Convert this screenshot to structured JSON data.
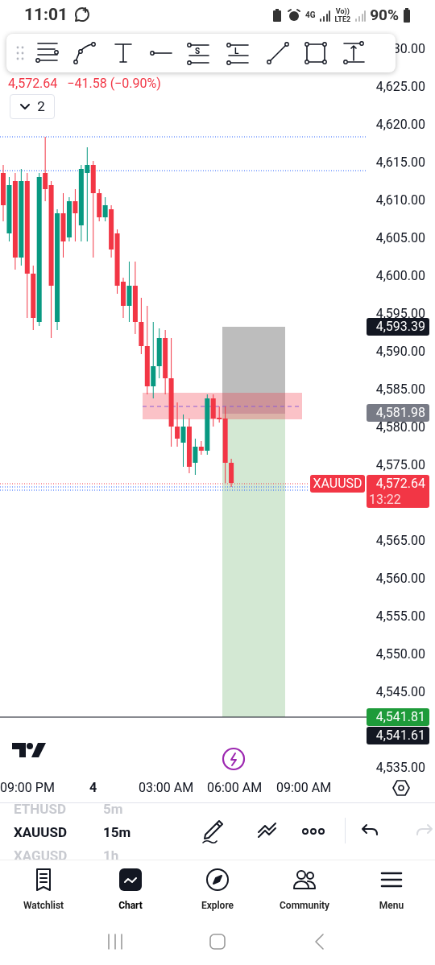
{
  "status_bar": {
    "time": "11:01",
    "network": [
      "4G",
      "Vo))",
      "LTE2"
    ],
    "battery": "90%"
  },
  "drawing_toolbar": {
    "tools": [
      {
        "kind": "fib"
      },
      {
        "kind": "curve"
      },
      {
        "kind": "text"
      },
      {
        "kind": "ray"
      },
      {
        "kind": "lettered",
        "letter": "S"
      },
      {
        "kind": "lettered",
        "letter": "L"
      },
      {
        "kind": "trend"
      },
      {
        "kind": "rectangle"
      },
      {
        "kind": "range"
      }
    ]
  },
  "chart": {
    "quote": {
      "price": "4,572.64",
      "change": "−41.58 (−0.90%)"
    },
    "legend_toggle": "2",
    "price_ticks": [
      "30.00",
      "4,625.00",
      "4,620.00",
      "4,615.00",
      "4,610.00",
      "4,605.00",
      "4,600.00",
      "4,595.00",
      "4,590.00",
      "4,585.00",
      "4,580.00",
      "4,575.00",
      "4,565.00",
      "4,560.00",
      "4,555.00",
      "4,550.00",
      "4,545.00",
      "4,535.00"
    ],
    "price_tags": [
      {
        "kind": "stop",
        "text": "4,593.39"
      },
      {
        "kind": "entry",
        "text": "4,581.98"
      },
      {
        "kind": "last",
        "symbol": "XAUUSD",
        "text": "4,572.64",
        "countdown": "13:22"
      },
      {
        "kind": "target",
        "text": "4,541.81"
      },
      {
        "kind": "low",
        "text": "4,541.61"
      }
    ],
    "time_ticks": [
      {
        "text": "09:00 PM",
        "major": false
      },
      {
        "text": "4",
        "major": true
      },
      {
        "text": "03:00 AM",
        "major": false
      },
      {
        "text": "06:00 AM",
        "major": false
      },
      {
        "text": "09:00 AM",
        "major": false
      }
    ]
  },
  "symbols": [
    {
      "symbol": "ETHUSD",
      "interval": "5m",
      "selected": false
    },
    {
      "symbol": "XAUUSD",
      "interval": "15m",
      "selected": true
    },
    {
      "symbol": "XAGUSD",
      "interval": "1h",
      "selected": false
    }
  ],
  "actions": [
    {
      "kind": "draw",
      "disabled": false
    },
    {
      "kind": "tools",
      "disabled": false
    },
    {
      "kind": "more",
      "disabled": false
    },
    {
      "kind": "undo",
      "disabled": false
    },
    {
      "kind": "redo",
      "disabled": true
    }
  ],
  "nav": [
    {
      "kind": "watchlist",
      "label": "Watchlist",
      "selected": false
    },
    {
      "kind": "chart",
      "label": "Chart",
      "selected": true
    },
    {
      "kind": "explore",
      "label": "Explore",
      "selected": false
    },
    {
      "kind": "community",
      "label": "Community",
      "selected": false
    },
    {
      "kind": "menu",
      "label": "Menu",
      "selected": false
    }
  ]
}
